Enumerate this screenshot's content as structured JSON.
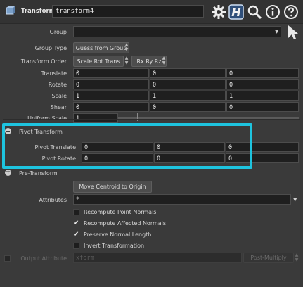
{
  "header": {
    "node_type": "Transform",
    "node_name": "transform4"
  },
  "group": {
    "label": "Group",
    "value": ""
  },
  "group_type": {
    "label": "Group Type",
    "value": "Guess from Group"
  },
  "transform_order": {
    "label": "Transform Order",
    "value1": "Scale Rot Trans",
    "value2": "Rx Ry Rz"
  },
  "translate": {
    "label": "Translate",
    "values": [
      "0",
      "0",
      "0"
    ]
  },
  "rotate": {
    "label": "Rotate",
    "values": [
      "0",
      "0",
      "0"
    ]
  },
  "scale": {
    "label": "Scale",
    "values": [
      "1",
      "1",
      "1"
    ]
  },
  "shear": {
    "label": "Shear",
    "values": [
      "0",
      "0",
      "0"
    ]
  },
  "uniform_scale": {
    "label": "Uniform Scale",
    "value": "1"
  },
  "pivot_transform": {
    "title": "Pivot Transform",
    "translate": {
      "label": "Pivot Translate",
      "values": [
        "0",
        "0",
        "0"
      ]
    },
    "rotate": {
      "label": "Pivot Rotate",
      "values": [
        "0",
        "0",
        "0"
      ]
    }
  },
  "pre_transform": {
    "title": "Pre-Transform"
  },
  "move_centroid_button": "Move Centroid to Origin",
  "attributes": {
    "label": "Attributes",
    "value": "*"
  },
  "checkboxes": [
    {
      "label": "Recompute Point Normals",
      "checked": false
    },
    {
      "label": "Recompute Affected Normals",
      "checked": true
    },
    {
      "label": "Preserve Normal Length",
      "checked": true
    },
    {
      "label": "Invert Transformation",
      "checked": false
    }
  ],
  "output_attribute": {
    "label": "Output Attribute",
    "value": "xform",
    "mode": "Post-Multiply"
  },
  "colors": {
    "highlight": "#1ec4df",
    "background": "#3a3a3a",
    "field": "#1f1f1f"
  }
}
